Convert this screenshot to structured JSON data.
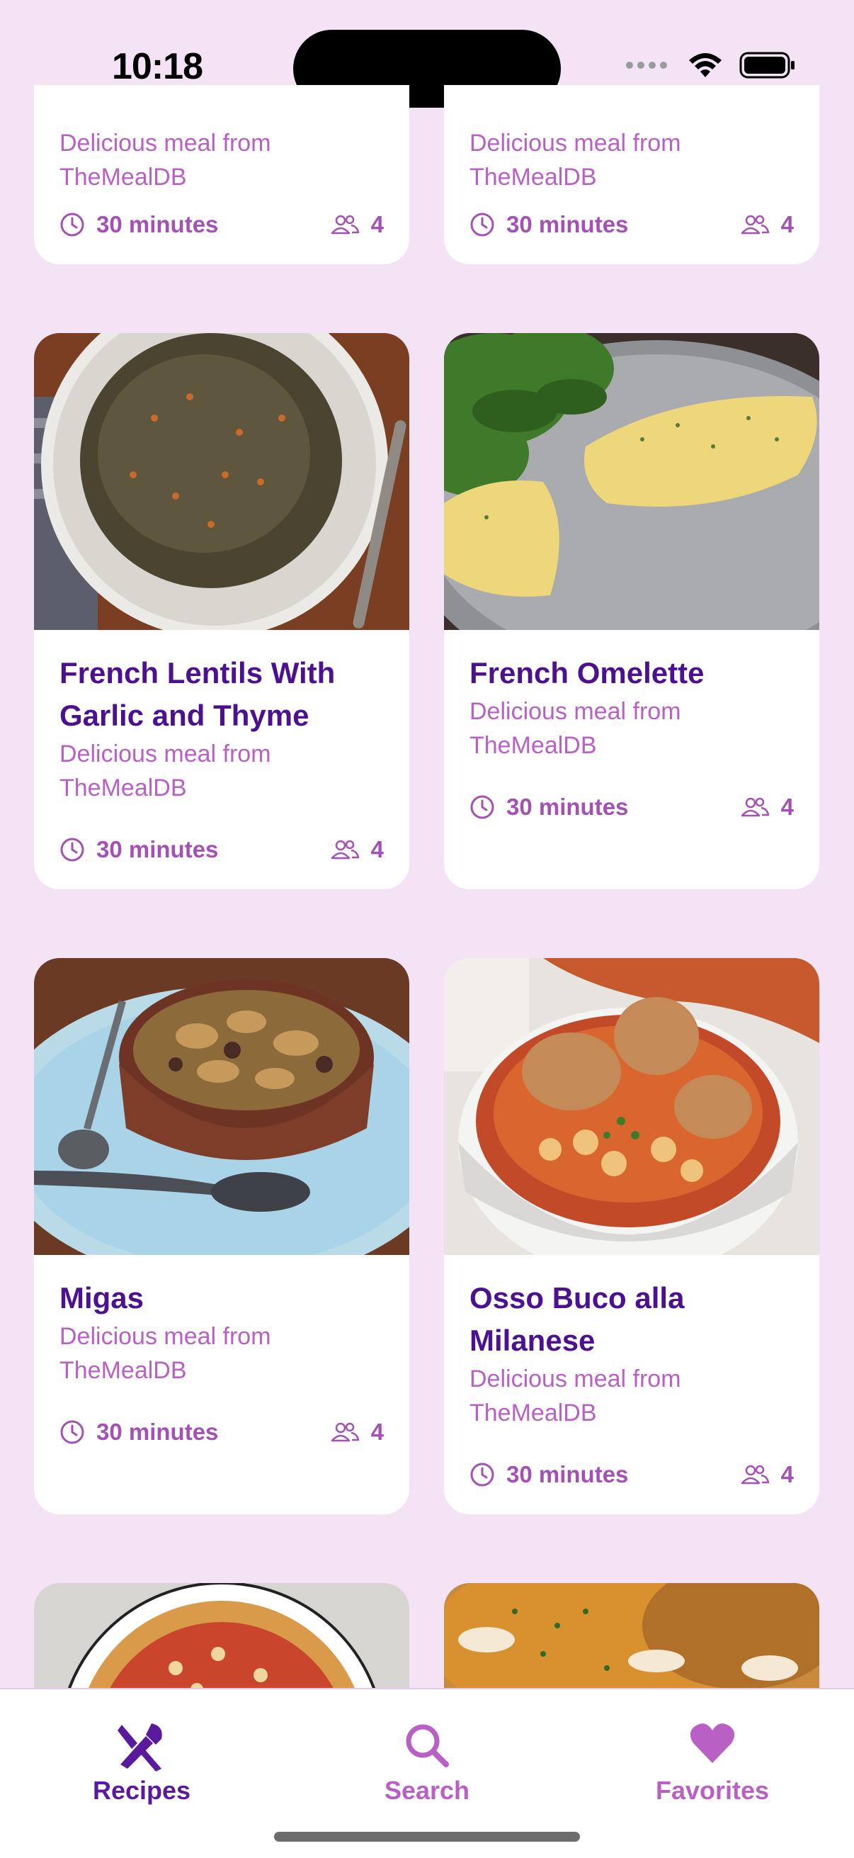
{
  "status_bar": {
    "time": "10:18"
  },
  "colors": {
    "background": "#F3E3F5",
    "title": "#4B1190",
    "subtitle": "#B860C4",
    "meta": "#A351B4",
    "tab_active": "#5A1A9E",
    "tab_inactive": "#B860C4"
  },
  "top_cards": [
    {
      "subtitle": "Delicious meal from TheMealDB",
      "time": "30 minutes",
      "servings": "4"
    },
    {
      "subtitle": "Delicious meal from TheMealDB",
      "time": "30 minutes",
      "servings": "4"
    }
  ],
  "cards": [
    {
      "title": "French Lentils With Garlic and Thyme",
      "subtitle": "Delicious meal from TheMealDB",
      "time": "30 minutes",
      "servings": "4"
    },
    {
      "title": "French Omelette",
      "subtitle": "Delicious meal from TheMealDB",
      "time": "30 minutes",
      "servings": "4"
    },
    {
      "title": "Migas",
      "subtitle": "Delicious meal from TheMealDB",
      "time": "30 minutes",
      "servings": "4"
    },
    {
      "title": "Osso Buco alla Milanese",
      "subtitle": "Delicious meal from TheMealDB",
      "time": "30 minutes",
      "servings": "4"
    }
  ],
  "tabs": [
    {
      "label": "Recipes",
      "icon": "fork-knife-icon",
      "active": true
    },
    {
      "label": "Search",
      "icon": "search-icon",
      "active": false
    },
    {
      "label": "Favorites",
      "icon": "heart-icon",
      "active": false
    }
  ]
}
